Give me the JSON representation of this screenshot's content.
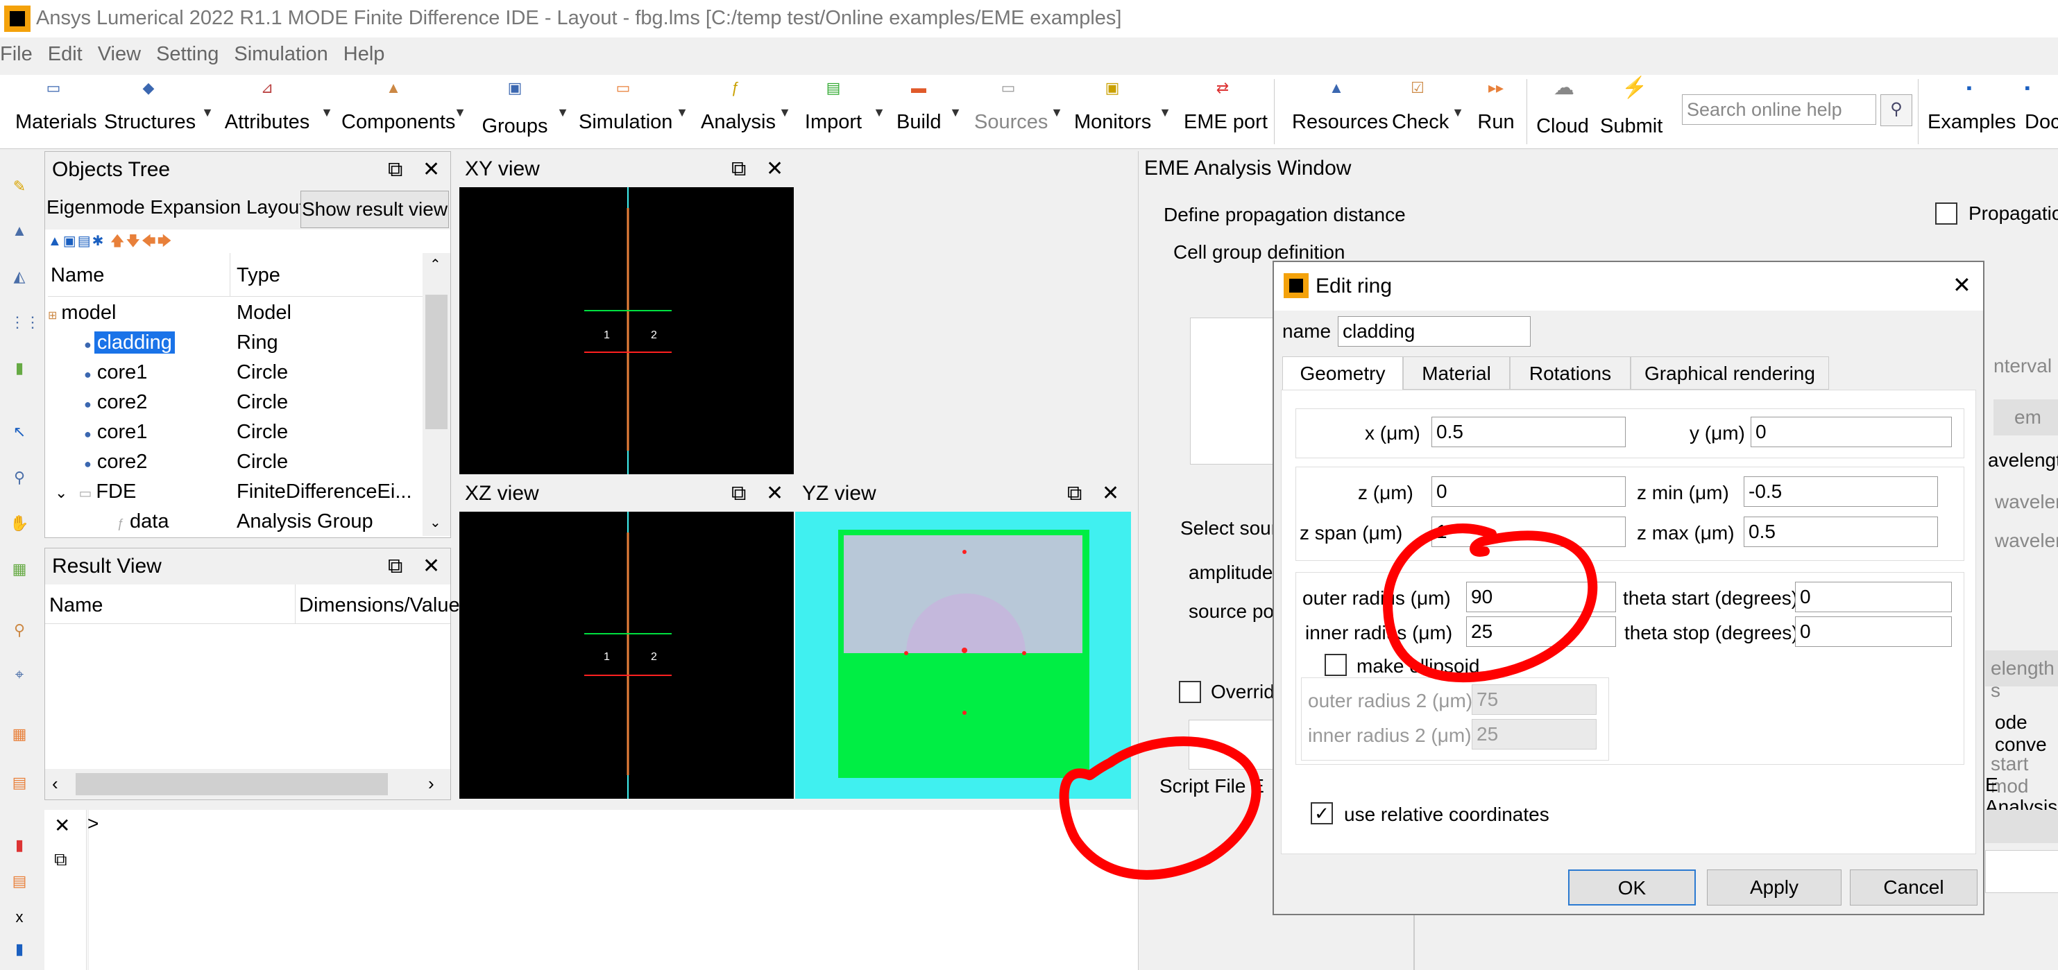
{
  "window": {
    "title": "Ansys Lumerical 2022 R1.1 MODE Finite Difference IDE - Layout - fbg.lms [C:/temp test/Online examples/EME examples]"
  },
  "menu": [
    "File",
    "Edit",
    "View",
    "Setting",
    "Simulation",
    "Help"
  ],
  "toolbar": {
    "materials": "Materials",
    "structures": "Structures",
    "attributes": "Attributes",
    "components": "Components",
    "groups": "Groups",
    "simulation": "Simulation",
    "analysis": "Analysis",
    "import": "Import",
    "build": "Build",
    "sources": "Sources",
    "monitors": "Monitors",
    "eme_port": "EME port",
    "resources": "Resources",
    "check": "Check",
    "run": "Run",
    "cloud": "Cloud",
    "submit": "Submit",
    "search_placeholder": "Search online help",
    "examples": "Examples",
    "docs": "Docs"
  },
  "objects_tree": {
    "title": "Objects Tree",
    "layout_label": "Eigenmode Expansion Layout",
    "show_result_btn": "Show result view",
    "col_name": "Name",
    "col_type": "Type",
    "rows": [
      {
        "name": "model",
        "type": "Model"
      },
      {
        "name": "cladding",
        "type": "Ring"
      },
      {
        "name": "core1",
        "type": "Circle"
      },
      {
        "name": "core2",
        "type": "Circle"
      },
      {
        "name": "core1",
        "type": "Circle"
      },
      {
        "name": "core2",
        "type": "Circle"
      },
      {
        "name": "FDE",
        "type": "FiniteDifferenceEi..."
      },
      {
        "name": "data",
        "type": "Analysis Group"
      }
    ]
  },
  "result_view": {
    "title": "Result View",
    "col_name": "Name",
    "col_dims": "Dimensions/Value"
  },
  "views": {
    "xy": "XY view",
    "xz": "XZ view",
    "yz": "YZ view",
    "port1": "1",
    "port2": "2"
  },
  "eme_window": {
    "title": "EME Analysis Window",
    "define_prop": "Define propagation distance",
    "cell_group": "Cell group definition",
    "propagation": "Propagatio",
    "interval": "nterval",
    "em": "em",
    "wavelength": "avelength",
    "wavelen1": "wavelen",
    "wavelen2": "wavelen",
    "elength": "elength s",
    "select_source": "Select sourc",
    "amplitude": "amplitude",
    "source_port": "source po",
    "mode_conv": "ode conve",
    "start_mod": "start mod",
    "e_analysis": "E Analysis",
    "override": "Override",
    "script_file": "Script File E"
  },
  "script_prompt": ">",
  "dialog": {
    "title": "Edit ring",
    "name_label": "name",
    "name_value": "cladding",
    "tabs": [
      "Geometry",
      "Material",
      "Rotations",
      "Graphical rendering"
    ],
    "x_label": "x (μm)",
    "x_value": "0.5",
    "y_label": "y (μm)",
    "y_value": "0",
    "z_label": "z (μm)",
    "z_value": "0",
    "zmin_label": "z min (μm)",
    "zmin_value": "-0.5",
    "zspan_label": "z span (μm)",
    "zspan_value": "1",
    "zmax_label": "z max (μm)",
    "zmax_value": "0.5",
    "outer_label": "outer radius (μm)",
    "outer_value": "90",
    "inner_label": "inner radius (μm)",
    "inner_value": "25",
    "theta_start_label": "theta start (degrees)",
    "theta_start_value": "0",
    "theta_stop_label": "theta stop (degrees)",
    "theta_stop_value": "0",
    "ellipsoid_label": "make ellipsoid",
    "outer2_label": "outer radius 2 (μm)",
    "outer2_value": "75",
    "inner2_label": "inner radius 2 (μm)",
    "inner2_value": "25",
    "relative_label": "use relative coordinates",
    "ok": "OK",
    "apply": "Apply",
    "cancel": "Cancel"
  },
  "colors": {
    "accent": "#2b7ad1",
    "annotation": "#ff0000",
    "cyan": "#40f0f0",
    "green": "#00ee44"
  }
}
